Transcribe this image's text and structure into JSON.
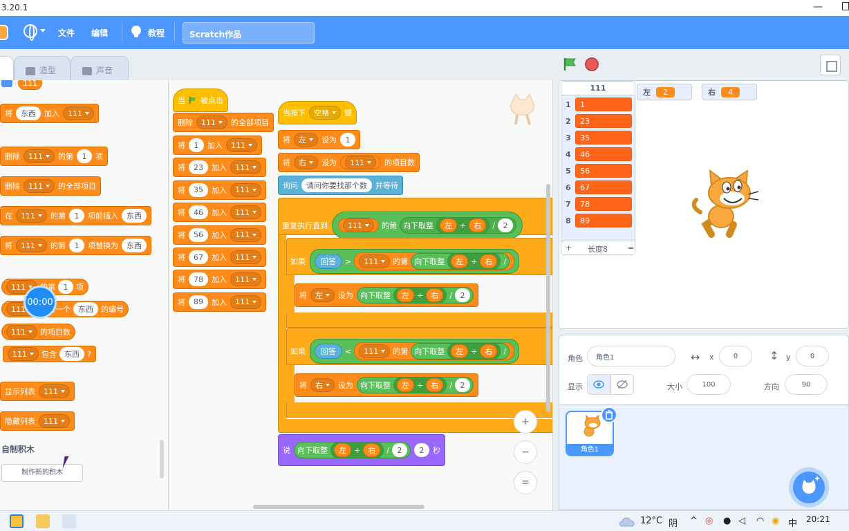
{
  "window": {
    "version": "3.20.1",
    "minimize": "—"
  },
  "menubar": {
    "file": "文件",
    "edit": "编辑",
    "tutorials": "教程",
    "project_title": "Scratch作品"
  },
  "tabs": {
    "costumes": "造型",
    "sounds": "声音"
  },
  "palette": {
    "list_reporter": "111",
    "add_block": {
      "pre": "将",
      "value": "东西",
      "mid": "加入",
      "list": "111"
    },
    "delete_block": {
      "pre": "删除",
      "list": "111",
      "mid": "的第",
      "value": "1",
      "post": "项"
    },
    "delete_all_block": {
      "pre": "删除",
      "list": "111",
      "post": "的全部项目"
    },
    "insert_block": {
      "pre": "在",
      "list": "111",
      "mid": "的第",
      "value": "1",
      "mid2": "项前插入",
      "value2": "东西"
    },
    "replace_block": {
      "pre": "将",
      "list": "111",
      "mid": "的第",
      "value": "1",
      "mid2": "项替换为",
      "value2": "东西"
    },
    "item_block": {
      "list": "111",
      "mid": "的第",
      "value": "1",
      "post": "项"
    },
    "itemnum_block": {
      "list": "111",
      "mid": "中第一个",
      "value": "东西",
      "post": "的编号"
    },
    "length_block": {
      "list": "111",
      "post": "的项目数"
    },
    "contains_block": {
      "list": "111",
      "mid": "包含",
      "value": "东西",
      "post": "?"
    },
    "show_list_block": {
      "pre": "显示列表",
      "list": "111"
    },
    "hide_list_block": {
      "pre": "隐藏列表",
      "list": "111"
    },
    "my_blocks_header": "自制积木",
    "make_block_button": "制作新的积木"
  },
  "timer": "00:00",
  "script1": {
    "hat": {
      "pre": "当",
      "post": "被点击"
    },
    "delete_all": {
      "pre": "删除",
      "list": "111",
      "post": "的全部项目"
    },
    "add_pre": "将",
    "add_mid": "加入",
    "add_list": "111",
    "values": [
      "1",
      "23",
      "35",
      "46",
      "56",
      "67",
      "78",
      "89"
    ]
  },
  "script2": {
    "hat": {
      "pre": "当按下",
      "key": "空格",
      "post": "键"
    },
    "set_left": {
      "pre": "将",
      "var": "左",
      "mid": "设为",
      "value": "1"
    },
    "set_right": {
      "pre": "将",
      "var": "右",
      "mid": "设为",
      "list": "111",
      "post": "的项目数"
    },
    "ask": {
      "pre": "询问",
      "question": "请问你要找那个数",
      "post": "并等待"
    },
    "repeat": {
      "pre": "重复执行直到",
      "list": "111",
      "mid": "的第",
      "floor": "向下取整",
      "left": "左",
      "plus": "+",
      "right": "右",
      "div": "/",
      "two": "2"
    },
    "if1": {
      "pre": "如果",
      "answer": "回答",
      "op": ">",
      "list": "111",
      "mid": "的第",
      "floor": "向下取整",
      "left": "左",
      "plus": "+",
      "right": "右",
      "div": "/"
    },
    "set1": {
      "pre": "将",
      "var": "左",
      "mid": "设为",
      "floor": "向下取整",
      "left": "左",
      "plus": "+",
      "right": "右",
      "div": "/",
      "two": "2"
    },
    "if2": {
      "pre": "如果",
      "answer": "回答",
      "op": "<",
      "list": "111",
      "mid": "的第",
      "floor": "向下取整",
      "left": "左",
      "plus": "+",
      "right": "右",
      "div": "/"
    },
    "set2": {
      "pre": "将",
      "var": "右",
      "mid": "设为",
      "floor": "向下取整",
      "left": "左",
      "plus": "+",
      "right": "右",
      "div": "/",
      "two": "2"
    },
    "say": {
      "pre": "说",
      "floor": "向下取整",
      "left": "左",
      "plus": "+",
      "right": "右",
      "div": "/",
      "two": "2",
      "secs": "2",
      "post": "秒"
    }
  },
  "zoom": {
    "in": "+",
    "out": "−",
    "reset": "="
  },
  "stage": {
    "list_monitor": {
      "name": "111",
      "items": [
        {
          "index": "1",
          "value": "1"
        },
        {
          "index": "2",
          "value": "23"
        },
        {
          "index": "3",
          "value": "35"
        },
        {
          "index": "4",
          "value": "46"
        },
        {
          "index": "5",
          "value": "56"
        },
        {
          "index": "6",
          "value": "67"
        },
        {
          "index": "7",
          "value": "78"
        },
        {
          "index": "8",
          "value": "89"
        }
      ],
      "add": "+",
      "length": "长度8",
      "resize": "="
    },
    "var_left": {
      "name": "左",
      "value": "2"
    },
    "var_right": {
      "name": "右",
      "value": "4"
    }
  },
  "sprite_info": {
    "sprite_label": "角色",
    "sprite_name": "角色1",
    "x_label": "x",
    "x_value": "0",
    "y_label": "y",
    "y_value": "0",
    "show_label": "显示",
    "size_label": "大小",
    "size_value": "100",
    "direction_label": "方向",
    "direction_value": "90"
  },
  "sprite_pane": {
    "thumb_name": "角色1"
  },
  "taskbar": {
    "temperature": "12°C",
    "weather": "阴",
    "ime": "中",
    "time": "20:21"
  },
  "colors": {
    "menubar": "#4c97ff",
    "data_block": "#ff8c1a",
    "control_block": "#ffab19",
    "event_block": "#ffbf00",
    "operator_block": "#59c059",
    "sensing_block": "#5cb1d6",
    "looks_block": "#9966ff"
  }
}
